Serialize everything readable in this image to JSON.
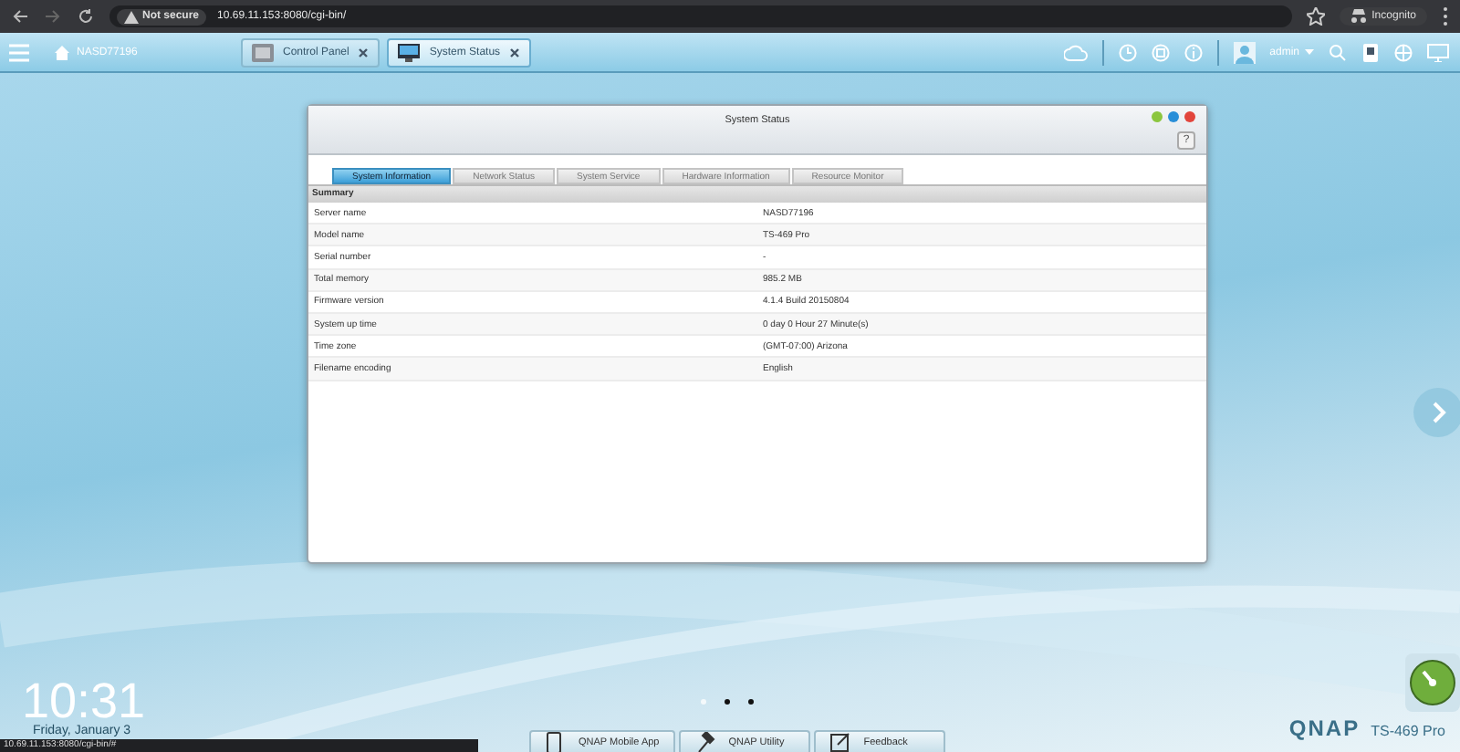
{
  "browser": {
    "security_label": "Not secure",
    "url": "10.69.11.153:8080/cgi-bin/",
    "profile": "Incognito",
    "status_url": "10.69.11.153:8080/cgi-bin/#"
  },
  "topbar": {
    "host": "NASD77196",
    "tabs": [
      {
        "label": "Control Panel",
        "kind": "panel",
        "selected": false
      },
      {
        "label": "System Status",
        "kind": "status",
        "selected": true
      }
    ],
    "user": "admin"
  },
  "window": {
    "title": "System Status",
    "help": "?",
    "tabs": [
      {
        "label": "System Information",
        "selected": true
      },
      {
        "label": "Network Status",
        "selected": false
      },
      {
        "label": "System Service",
        "selected": false
      },
      {
        "label": "Hardware Information",
        "selected": false
      },
      {
        "label": "Resource Monitor",
        "selected": false
      }
    ],
    "section": "Summary",
    "rows": [
      {
        "label": "Server name",
        "value": "NASD77196"
      },
      {
        "label": "Model name",
        "value": "TS-469 Pro"
      },
      {
        "label": "Serial number",
        "value": "-"
      },
      {
        "label": "Total memory",
        "value": "985.2 MB"
      },
      {
        "label": "Firmware version",
        "value": "4.1.4 Build 20150804"
      },
      {
        "label": "System up time",
        "value": "0 day 0 Hour 27 Minute(s)"
      },
      {
        "label": "Time zone",
        "value": "(GMT-07:00) Arizona"
      },
      {
        "label": "Filename encoding",
        "value": "English"
      }
    ]
  },
  "desktop": {
    "clock": "10:31",
    "date": "Friday, January 3",
    "page_dots": [
      {
        "selected": true
      },
      {
        "selected": false
      },
      {
        "selected": false
      }
    ],
    "dock": [
      {
        "label": "QNAP Mobile App",
        "kind": "phone"
      },
      {
        "label": "QNAP Utility",
        "kind": "tool"
      },
      {
        "label": "Feedback",
        "kind": "edit"
      }
    ],
    "brand": "QNAP",
    "model": "TS-469 Pro"
  }
}
